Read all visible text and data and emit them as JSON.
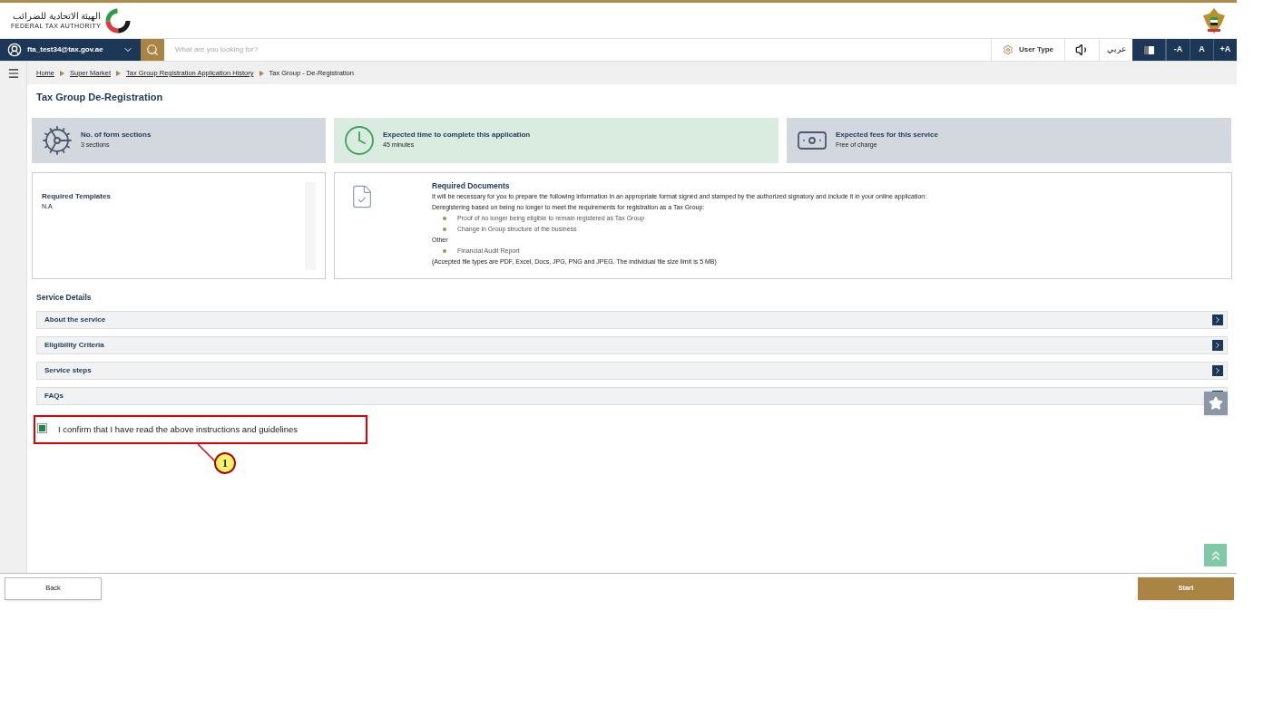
{
  "header": {
    "logo_arabic": "الهيئة الاتحادية للضرائب",
    "logo_english": "FEDERAL TAX AUTHORITY"
  },
  "nav": {
    "user": "fta_test34@tax.gov.ae",
    "search_placeholder": "What are you looking for?",
    "user_type": "User Type",
    "language": "عربي",
    "font_buttons": [
      "-A",
      "A",
      "+A"
    ]
  },
  "breadcrumb": [
    {
      "label": "Home",
      "link": true
    },
    {
      "label": "Super Market",
      "link": true
    },
    {
      "label": "Tax Group Registration Application History",
      "link": true
    },
    {
      "label": "Tax Group - De-Registration",
      "link": false
    }
  ],
  "page_title": "Tax Group De-Registration",
  "info_cards": [
    {
      "kind": "sections",
      "title": "No. of form sections",
      "value": "3 sections",
      "highlight": false
    },
    {
      "kind": "time",
      "title": "Expected time to complete this application",
      "value": "45 minutes",
      "highlight": true
    },
    {
      "kind": "fees",
      "title": "Expected fees for this service",
      "value": "Free of charge",
      "highlight": false
    }
  ],
  "templates": {
    "title": "Required Templates",
    "value": "N.A"
  },
  "documents": {
    "title": "Required Documents",
    "intro": "It will be necessary for you to prepare the following information in an appropriate format signed and stamped by the authorized signatory and include it in your online application:",
    "groups": [
      {
        "heading": "Deregistering based on being no longer to meet the requirements for registration as a Tax Group:",
        "items": [
          "Proof of no longer being eligible to remain registered as Tax Group",
          "Change in Group structure of the business"
        ]
      },
      {
        "heading": "Other",
        "items": [
          "Financial Audit Report"
        ]
      }
    ],
    "note": "(Accepted file types are PDF, Excel, Docs, JPG, PNG and JPEG. The individual file size limit is 5 MB)"
  },
  "service_details": {
    "title": "Service Details",
    "sections": [
      {
        "label": "About the service"
      },
      {
        "label": "Eligibility Criteria"
      },
      {
        "label": "Service steps"
      },
      {
        "label": "FAQs"
      }
    ]
  },
  "confirm": {
    "label": "I confirm that I have read the above instructions and guidelines",
    "checked": true
  },
  "callout": "1",
  "footer": {
    "back": "Back",
    "start": "Start"
  }
}
